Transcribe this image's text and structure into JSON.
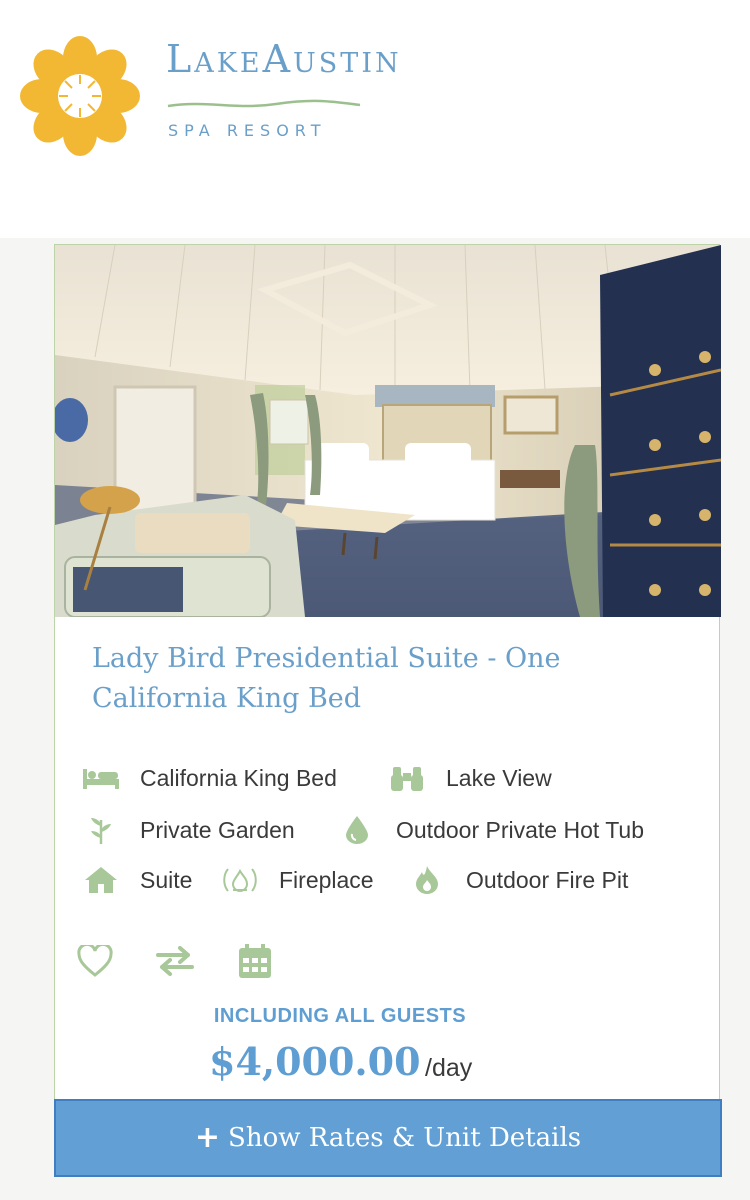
{
  "brand": {
    "name": "LakeAustin",
    "subtitle": "SPA RESORT",
    "colors": {
      "petal": "#f2b833",
      "text": "#6a9fc9",
      "wave": "#9bc08e"
    }
  },
  "room": {
    "title": "Lady Bird Presidential Suite - One California King Bed",
    "photo_icon": "bedroom-photo",
    "amenities": [
      {
        "icon": "bed-icon",
        "label": "California King Bed"
      },
      {
        "icon": "binoculars-icon",
        "label": "Lake View"
      },
      {
        "icon": "leaf-icon",
        "label": "Private Garden"
      },
      {
        "icon": "water-drop-icon",
        "label": "Outdoor Private Hot Tub"
      },
      {
        "icon": "house-icon",
        "label": "Suite"
      },
      {
        "icon": "fireplace-icon",
        "label": "Fireplace"
      },
      {
        "icon": "flame-icon",
        "label": "Outdoor Fire Pit"
      }
    ],
    "actions": [
      {
        "icon": "heart-icon",
        "label": "favorite"
      },
      {
        "icon": "compare-arrows-icon",
        "label": "compare"
      },
      {
        "icon": "calendar-icon",
        "label": "availability"
      }
    ],
    "price": {
      "caption": "INCLUDING ALL GUESTS",
      "amount": "$4,000.00",
      "unit": "/day"
    },
    "cta": {
      "label": "Show Rates & Unit Details",
      "icon": "plus-icon"
    }
  },
  "colors": {
    "accent": "#629fd4",
    "icon_green": "#a8c89a",
    "border": "#bcd4a8"
  }
}
